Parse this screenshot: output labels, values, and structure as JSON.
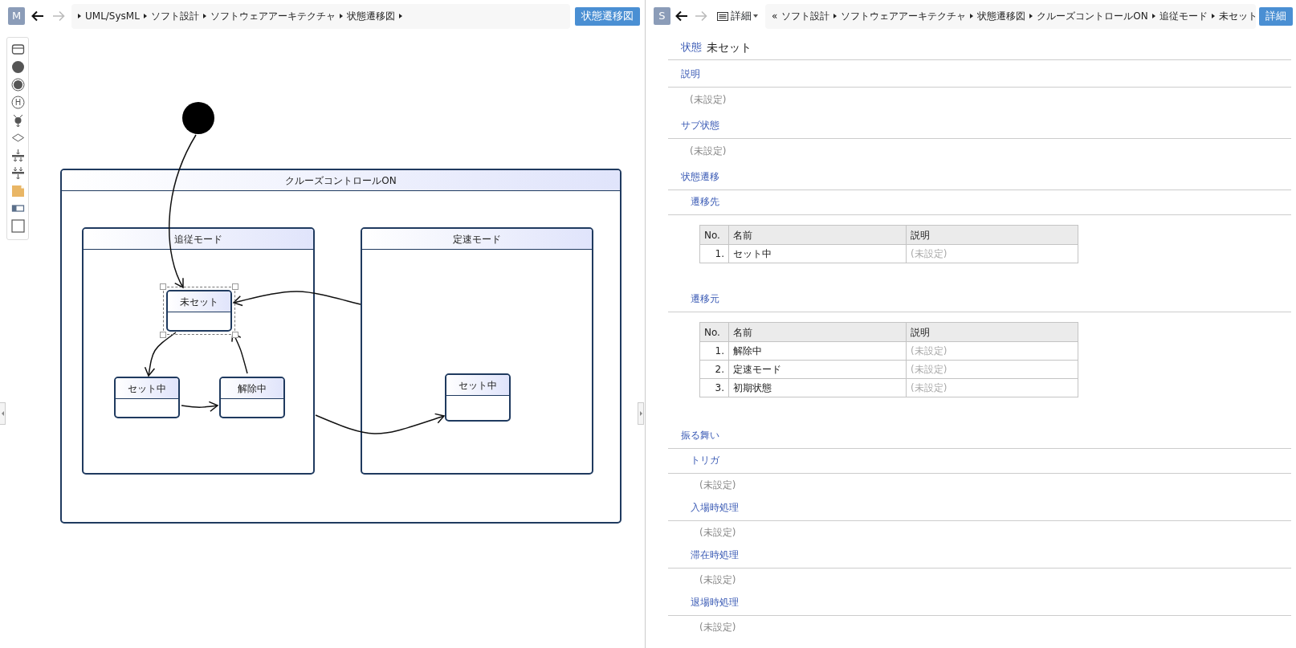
{
  "left_pane": {
    "avatar": "M",
    "breadcrumb": [
      "UML/SysML",
      "ソフト設計",
      "ソフトウェアアーキテクチャ",
      "状態遷移図"
    ],
    "view_button": "状態遷移図",
    "palette": [
      {
        "kind": "state"
      },
      {
        "kind": "initial"
      },
      {
        "kind": "final"
      },
      {
        "kind": "history",
        "label": "H"
      },
      {
        "kind": "choice"
      },
      {
        "kind": "decision"
      },
      {
        "kind": "join"
      },
      {
        "kind": "fork"
      },
      {
        "kind": "note"
      },
      {
        "kind": "partition"
      },
      {
        "kind": "frame"
      }
    ],
    "diagram": {
      "states": [
        {
          "name": "クルーズコントロールON",
          "selected": false,
          "children": [
            {
              "name": "追従モード",
              "selected": false,
              "children": [
                {
                  "name": "未セット",
                  "selected": true
                },
                {
                  "name": "セット中",
                  "selected": false
                },
                {
                  "name": "解除中",
                  "selected": false
                }
              ]
            },
            {
              "name": "定速モード",
              "selected": false,
              "children": [
                {
                  "name": "セット中",
                  "selected": false
                }
              ]
            }
          ]
        }
      ]
    }
  },
  "right_pane": {
    "avatar": "S",
    "view_menu": "詳細",
    "breadcrumb_back": "«",
    "breadcrumb": [
      "ソフト設計",
      "ソフトウェアアーキテクチャ",
      "状態遷移図",
      "クルーズコントロールON",
      "追従モード",
      "未セット"
    ],
    "detail_button": "詳細",
    "title": {
      "kind_label": "状態",
      "name": "未セット"
    },
    "sections": [
      {
        "heading": "説明",
        "value": "(未設定)"
      },
      {
        "heading": "サブ状態",
        "value": "(未設定)"
      },
      {
        "heading": "状態遷移",
        "subsections": [
          {
            "heading": "遷移先",
            "table": {
              "columns": [
                "No.",
                "名前",
                "説明"
              ],
              "rows": [
                [
                  "1.",
                  "セット中",
                  "(未設定)"
                ]
              ]
            }
          },
          {
            "heading": "遷移元",
            "table": {
              "columns": [
                "No.",
                "名前",
                "説明"
              ],
              "rows": [
                [
                  "1.",
                  "解除中",
                  "(未設定)"
                ],
                [
                  "2.",
                  "定速モード",
                  "(未設定)"
                ],
                [
                  "3.",
                  "初期状態",
                  "(未設定)"
                ]
              ]
            }
          }
        ]
      },
      {
        "heading": "振る舞い",
        "subsections": [
          {
            "heading": "トリガ",
            "value": "(未設定)"
          },
          {
            "heading": "入場時処理",
            "value": "(未設定)"
          },
          {
            "heading": "滞在時処理",
            "value": "(未設定)"
          },
          {
            "heading": "退場時処理",
            "value": "(未設定)"
          }
        ]
      }
    ]
  }
}
